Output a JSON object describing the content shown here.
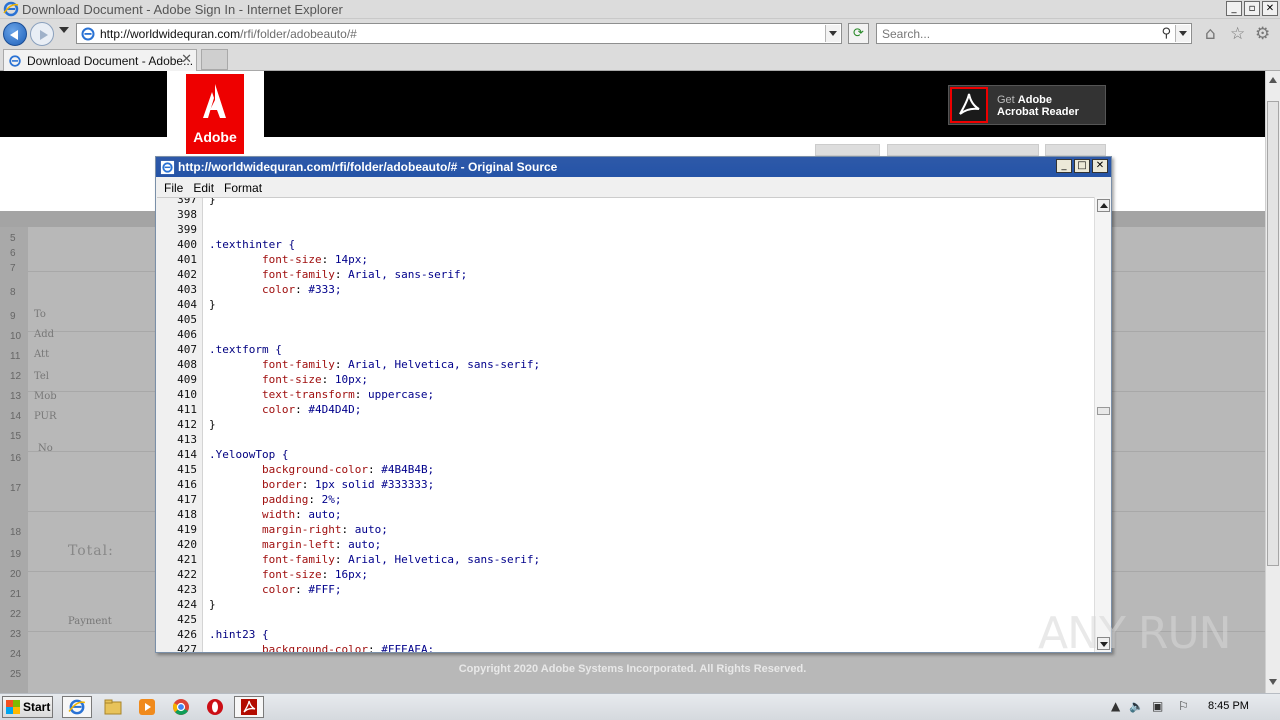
{
  "browser": {
    "window_title": "Download Document - Adobe Sign In - Internet Explorer",
    "url_host": "http://worldwidequran.com",
    "url_path": "/rfi/folder/adobeauto/#",
    "search_placeholder": "Search...",
    "tab_label": "Download Document - Adobe...",
    "window_buttons": [
      "_",
      "▫",
      "✕"
    ]
  },
  "page": {
    "logo_text": "Adobe",
    "get_reader_line1_prefix": "Get ",
    "get_reader_line1_brand": "Adobe",
    "get_reader_line2": "Acrobat Reader",
    "footer": "Copyright 2020 Adobe Systems Incorporated. All Rights Reserved.",
    "sheet_rows": [
      "5",
      "6",
      "7",
      "8",
      "9",
      "10",
      "11",
      "12",
      "13",
      "14",
      "15",
      "16",
      "17",
      "18",
      "19",
      "20",
      "21",
      "22",
      "23",
      "24",
      "25"
    ],
    "sheet_texts": [
      "To",
      "Add",
      "Att",
      "Tel",
      "Mob",
      "PUR",
      "No",
      "Total:",
      "Payment"
    ]
  },
  "source_window": {
    "title": "http://worldwidequran.com/rfi/folder/adobeauto/# - Original Source",
    "menu": [
      "File",
      "Edit",
      "Format"
    ],
    "lines": [
      {
        "n": "397",
        "t": "}"
      },
      {
        "n": "398",
        "t": ""
      },
      {
        "n": "399",
        "t": ""
      },
      {
        "n": "400",
        "t": ".texthinter {"
      },
      {
        "n": "401",
        "t": "        font-size: 14px;"
      },
      {
        "n": "402",
        "t": "        font-family: Arial, sans-serif;"
      },
      {
        "n": "403",
        "t": "        color: #333;"
      },
      {
        "n": "404",
        "t": "}"
      },
      {
        "n": "405",
        "t": ""
      },
      {
        "n": "406",
        "t": ""
      },
      {
        "n": "407",
        "t": ".textform {"
      },
      {
        "n": "408",
        "t": "        font-family: Arial, Helvetica, sans-serif;"
      },
      {
        "n": "409",
        "t": "        font-size: 10px;"
      },
      {
        "n": "410",
        "t": "        text-transform: uppercase;"
      },
      {
        "n": "411",
        "t": "        color: #4D4D4D;"
      },
      {
        "n": "412",
        "t": "}"
      },
      {
        "n": "413",
        "t": ""
      },
      {
        "n": "414",
        "t": ".YeloowTop {"
      },
      {
        "n": "415",
        "t": "        background-color: #4B4B4B;"
      },
      {
        "n": "416",
        "t": "        border: 1px solid #333333;"
      },
      {
        "n": "417",
        "t": "        padding: 2%;"
      },
      {
        "n": "418",
        "t": "        width: auto;"
      },
      {
        "n": "419",
        "t": "        margin-right: auto;"
      },
      {
        "n": "420",
        "t": "        margin-left: auto;"
      },
      {
        "n": "421",
        "t": "        font-family: Arial, Helvetica, sans-serif;"
      },
      {
        "n": "422",
        "t": "        font-size: 16px;"
      },
      {
        "n": "423",
        "t": "        color: #FFF;"
      },
      {
        "n": "424",
        "t": "}"
      },
      {
        "n": "425",
        "t": ""
      },
      {
        "n": "426",
        "t": ".hint23 {"
      },
      {
        "n": "427",
        "t": "        background-color: #FFEAEA;"
      }
    ]
  },
  "taskbar": {
    "start_label": "Start",
    "clock": "8:45 PM"
  },
  "watermark": "ANY RUN",
  "colors": {
    "accent_red": "#EE0000",
    "title_blue": "#2554A7"
  }
}
